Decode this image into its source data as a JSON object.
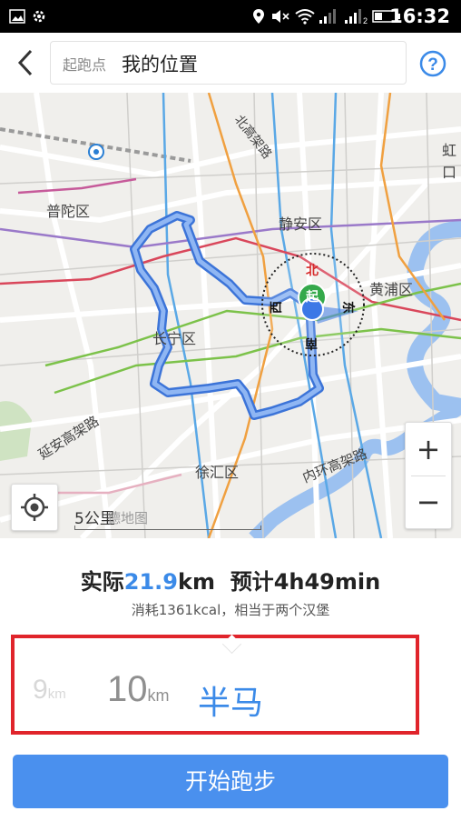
{
  "status_bar": {
    "time": "16:32"
  },
  "header": {
    "start_label": "起跑点",
    "start_value": "我的位置"
  },
  "map": {
    "districts": {
      "putuo": "普陀区",
      "jingan": "静安区",
      "huangpu": "黄浦区",
      "changning": "长宁区",
      "xuhui": "徐汇区",
      "hongkou": "虹口"
    },
    "roads": {
      "north_elevated": "北高架路",
      "yanan_elevated": "延安高架路",
      "inner_ring": "内环高架路"
    },
    "compass": {
      "north": "北",
      "south": "南",
      "east": "东",
      "west": "西"
    },
    "start_marker": "起",
    "scale_label": "5公里",
    "watermark": "德地图",
    "zoom_in": "+",
    "zoom_out": "−"
  },
  "summary": {
    "actual_label": "实际",
    "actual_distance": "21.9",
    "actual_unit": "km",
    "estimate_label": "预计",
    "estimate_time": "4h49min",
    "calories_text": "消耗1361kcal，相当于两个汉堡"
  },
  "distance_options": [
    {
      "value": "9",
      "unit": "km"
    },
    {
      "value": "10",
      "unit": "km"
    },
    {
      "value": "半马",
      "unit": ""
    }
  ],
  "start_button": "开始跑步",
  "colors": {
    "accent": "#3b8ae8",
    "button": "#4a90ee",
    "highlight_border": "#e0242b"
  }
}
